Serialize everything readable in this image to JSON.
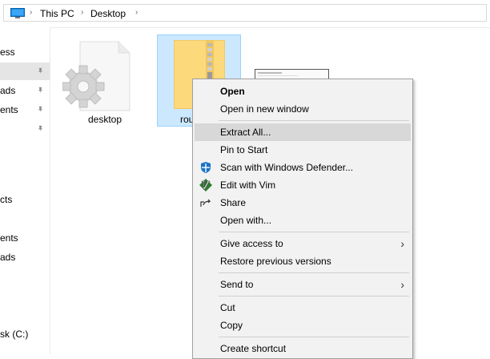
{
  "address": {
    "crumbs": [
      "This PC",
      "Desktop"
    ],
    "separator": "›"
  },
  "nav": {
    "items": [
      {
        "label": "ess",
        "pinned": false,
        "selected": false
      },
      {
        "label": "",
        "pinned": true,
        "selected": true
      },
      {
        "label": "ads",
        "pinned": true,
        "selected": false
      },
      {
        "label": "ents",
        "pinned": true,
        "selected": false
      },
      {
        "label": "",
        "pinned": true,
        "selected": false
      },
      {
        "label": "cts",
        "pinned": false,
        "selected": false
      },
      {
        "label": "ents",
        "pinned": false,
        "selected": false
      },
      {
        "label": "ads",
        "pinned": false,
        "selected": false
      },
      {
        "label": "sk (C:)",
        "pinned": false,
        "selected": false
      }
    ]
  },
  "files": [
    {
      "name": "desktop",
      "icon": "settings-file-icon"
    },
    {
      "name": "rou",
      "icon": "zip-folder-icon",
      "selected": true
    },
    {
      "name": "",
      "icon": "screenshot-thumbnail-icon"
    }
  ],
  "context_menu": {
    "items": [
      {
        "label": "Open",
        "bold": true
      },
      {
        "label": "Open in new window"
      },
      {
        "label": "Extract All...",
        "highlighted": true
      },
      {
        "label": "Pin to Start"
      },
      {
        "label": "Scan with Windows Defender...",
        "icon": "windows-defender-icon"
      },
      {
        "label": "Edit with Vim",
        "icon": "vim-icon"
      },
      {
        "label": "Share",
        "icon": "share-icon"
      },
      {
        "label": "Open with..."
      },
      {
        "label": "Give access to",
        "submenu": true
      },
      {
        "label": "Restore previous versions"
      },
      {
        "label": "Send to",
        "submenu": true
      },
      {
        "label": "Cut"
      },
      {
        "label": "Copy"
      },
      {
        "label": "Create shortcut"
      }
    ],
    "submenu_arrow": "›"
  },
  "colors": {
    "selection": "#cce8ff",
    "selection_border": "#99d1ff",
    "menu_bg": "#f2f2f2",
    "menu_highlight": "#d8d8d8",
    "nav_selected": "#e5e5e5"
  }
}
